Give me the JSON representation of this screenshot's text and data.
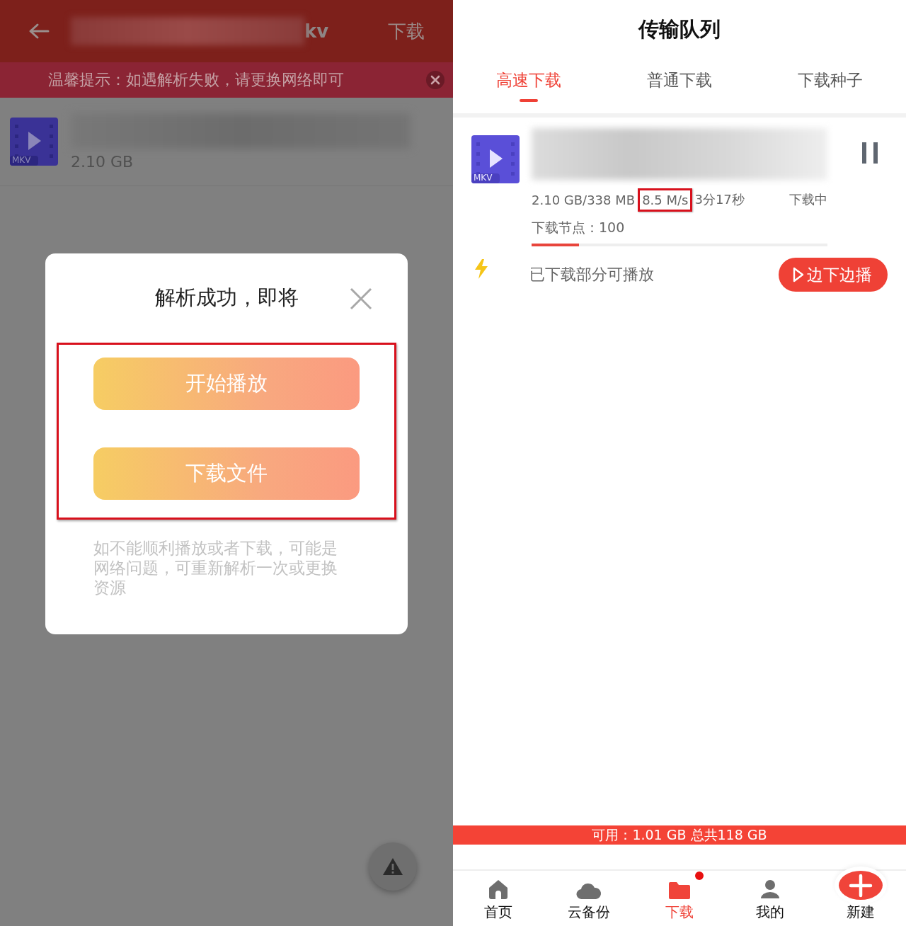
{
  "left_screen": {
    "header": {
      "title_visible": "kv",
      "action": "下载"
    },
    "notice": {
      "text": "温馨提示：如遇解析失败，请更换网络即可"
    },
    "file": {
      "type_label": "MKV",
      "size": "2.10 GB"
    },
    "dialog": {
      "title": "解析成功，即将",
      "buttons": [
        {
          "label": "开始播放"
        },
        {
          "label": "下载文件"
        }
      ],
      "buttons_highlighted": true,
      "hint": "如不能顺利播放或者下载，可能是网络问题，可重新解析一次或更换资源"
    }
  },
  "right_screen": {
    "title": "传输队列",
    "tabs": [
      {
        "label": "高速下载",
        "selected": true
      },
      {
        "label": "普通下载",
        "selected": false
      },
      {
        "label": "下载种子",
        "selected": false
      }
    ],
    "task": {
      "type_label": "MKV",
      "progress": "2.10 GB/338 MB",
      "speed": "8.5 M/s",
      "speed_highlighted": true,
      "remaining": "3分17秒",
      "status": "下载中",
      "nodes": "下载节点：100",
      "level": 0.16,
      "partial_note": "已下载部分可播放",
      "play_button": "边下边播"
    },
    "storage": "可用：1.01 GB 总共118 GB",
    "nav": [
      {
        "label": "首页",
        "kind": "tab",
        "selected": false,
        "badge": false
      },
      {
        "label": "云备份",
        "kind": "tab",
        "selected": false,
        "badge": false
      },
      {
        "label": "下载",
        "kind": "tab",
        "selected": true,
        "badge": true
      },
      {
        "label": "我的",
        "kind": "tab",
        "selected": false,
        "badge": false
      },
      {
        "label": "新建",
        "kind": "create"
      }
    ]
  }
}
